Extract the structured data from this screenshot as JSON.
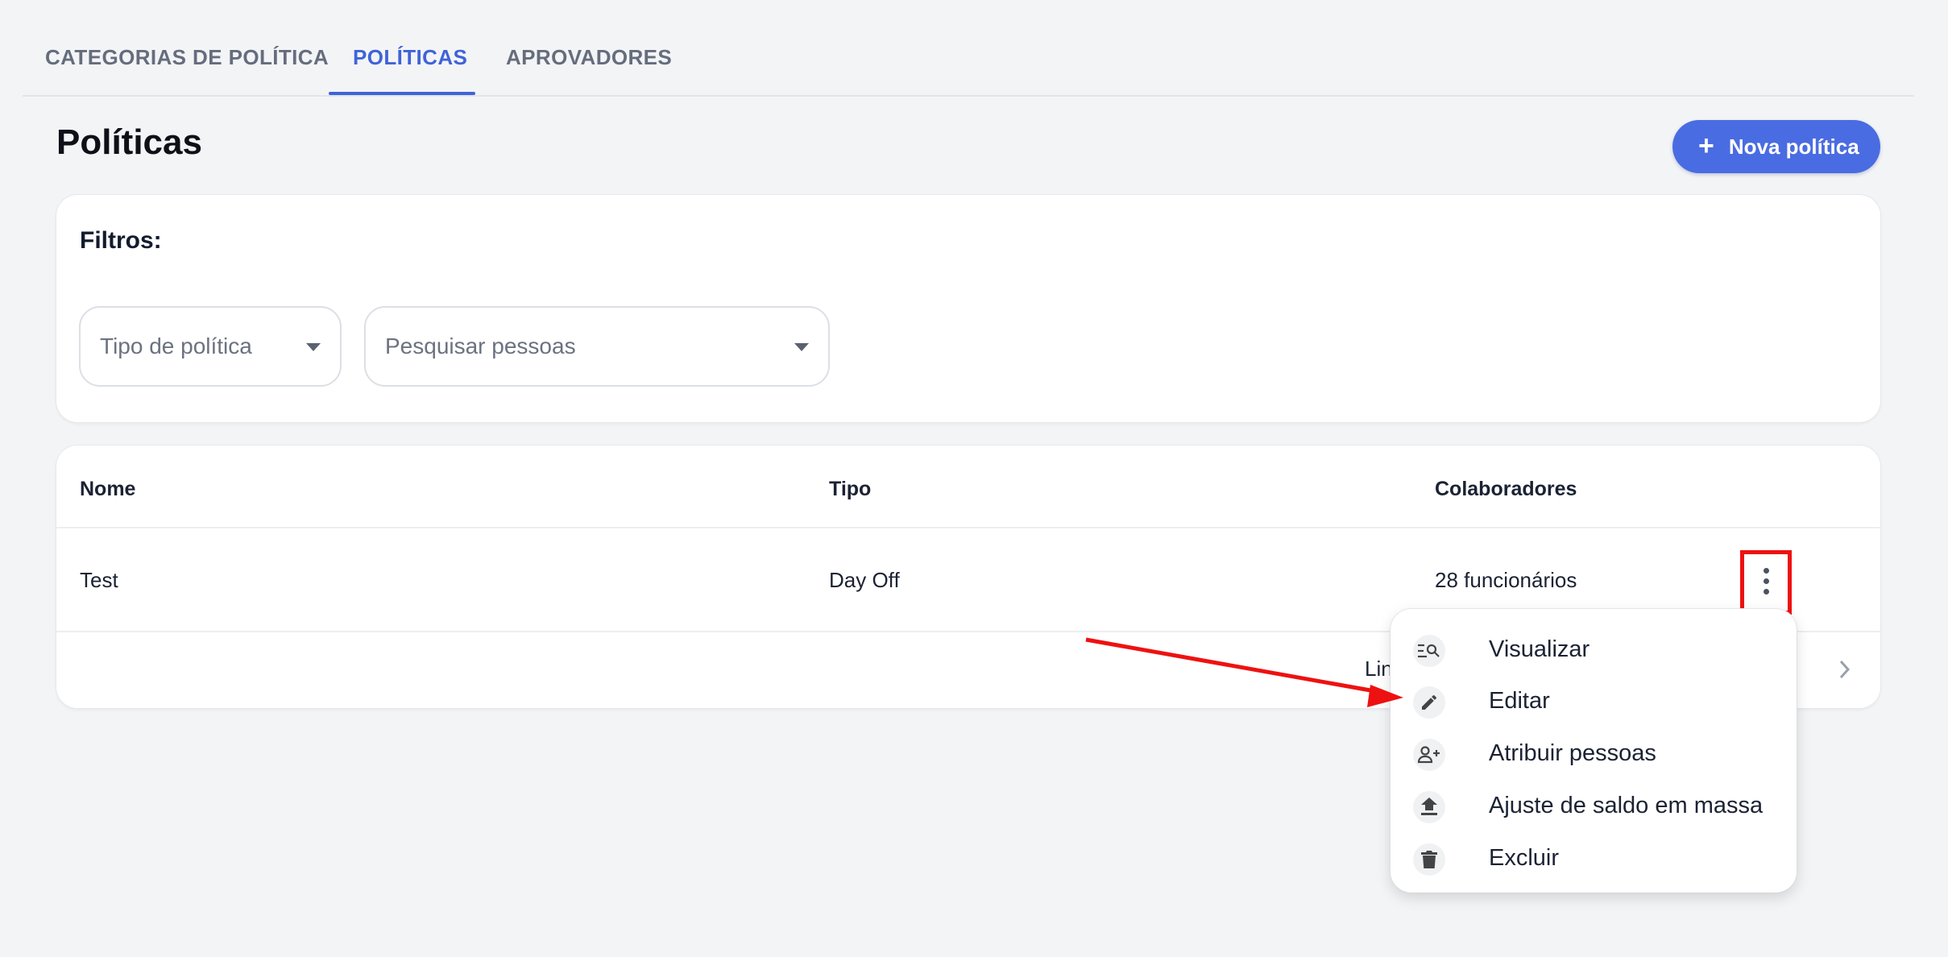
{
  "tabs": [
    {
      "label": "CATEGORIAS DE POLÍTICA"
    },
    {
      "label": "POLÍTICAS"
    },
    {
      "label": "APROVADORES"
    }
  ],
  "header": {
    "title": "Políticas",
    "new_button_label": "Nova política",
    "new_button_icon": "plus-icon"
  },
  "filters": {
    "title": "Filtros:",
    "policy_type_placeholder": "Tipo de política",
    "people_search_placeholder": "Pesquisar pessoas"
  },
  "table": {
    "columns": [
      "Nome",
      "Tipo",
      "Colaboradores"
    ],
    "rows": [
      {
        "name": "Test",
        "type": "Day Off",
        "collaborators": "28 funcionários"
      }
    ],
    "pagination_label_partial": "Lin"
  },
  "menu": {
    "items": [
      {
        "label": "Visualizar",
        "icon": "view-list-icon"
      },
      {
        "label": "Editar",
        "icon": "pencil-icon"
      },
      {
        "label": "Atribuir pessoas",
        "icon": "add-person-icon"
      },
      {
        "label": "Ajuste de saldo em massa",
        "icon": "upload-icon"
      },
      {
        "label": "Excluir",
        "icon": "trash-icon"
      }
    ]
  },
  "colors": {
    "accent": "#3f63d8",
    "button": "#4a6ce2",
    "annotation": "#ee1111",
    "background": "#f3f4f6"
  }
}
